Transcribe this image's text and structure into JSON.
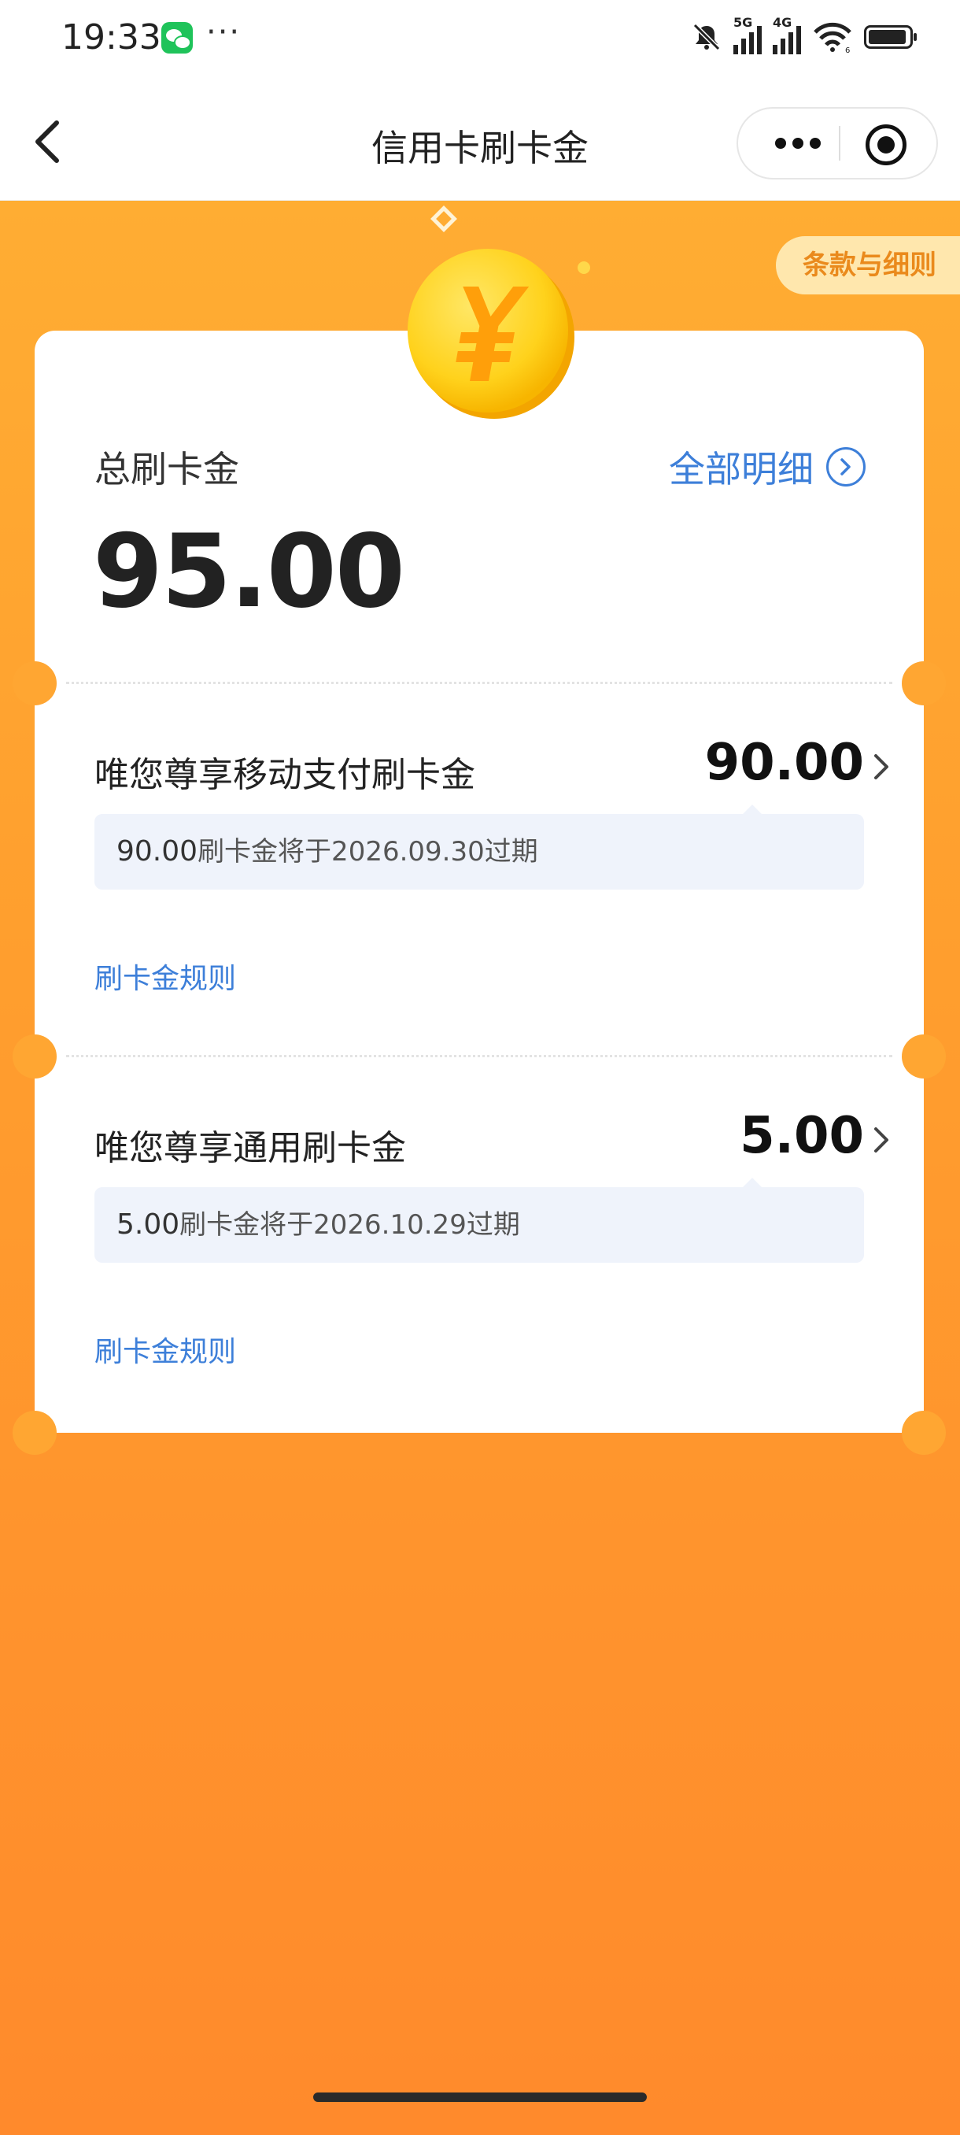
{
  "status_bar": {
    "time": "19:33",
    "more": "···",
    "signal1_tag": "5G",
    "signal2_tag": "4G",
    "wifi_tag": "6"
  },
  "nav": {
    "title": "信用卡刷卡金"
  },
  "terms_label": "条款与细则",
  "summary": {
    "total_label": "总刷卡金",
    "total_amount": "95.00",
    "detail_link": "全部明细"
  },
  "sections": [
    {
      "title": "唯您尊享移动支付刷卡金",
      "amount": "90.00",
      "expiry_amount": "90.00",
      "expiry_text": "刷卡金将于2026.09.30过期",
      "rule_link": "刷卡金规则"
    },
    {
      "title": "唯您尊享通用刷卡金",
      "amount": "5.00",
      "expiry_amount": "5.00",
      "expiry_text": "刷卡金将于2026.10.29过期",
      "rule_link": "刷卡金规则"
    }
  ],
  "colors": {
    "accent_blue": "#3d7fd9",
    "background_orange": "#ff9e2e",
    "terms_bg": "#ffe7ad"
  }
}
